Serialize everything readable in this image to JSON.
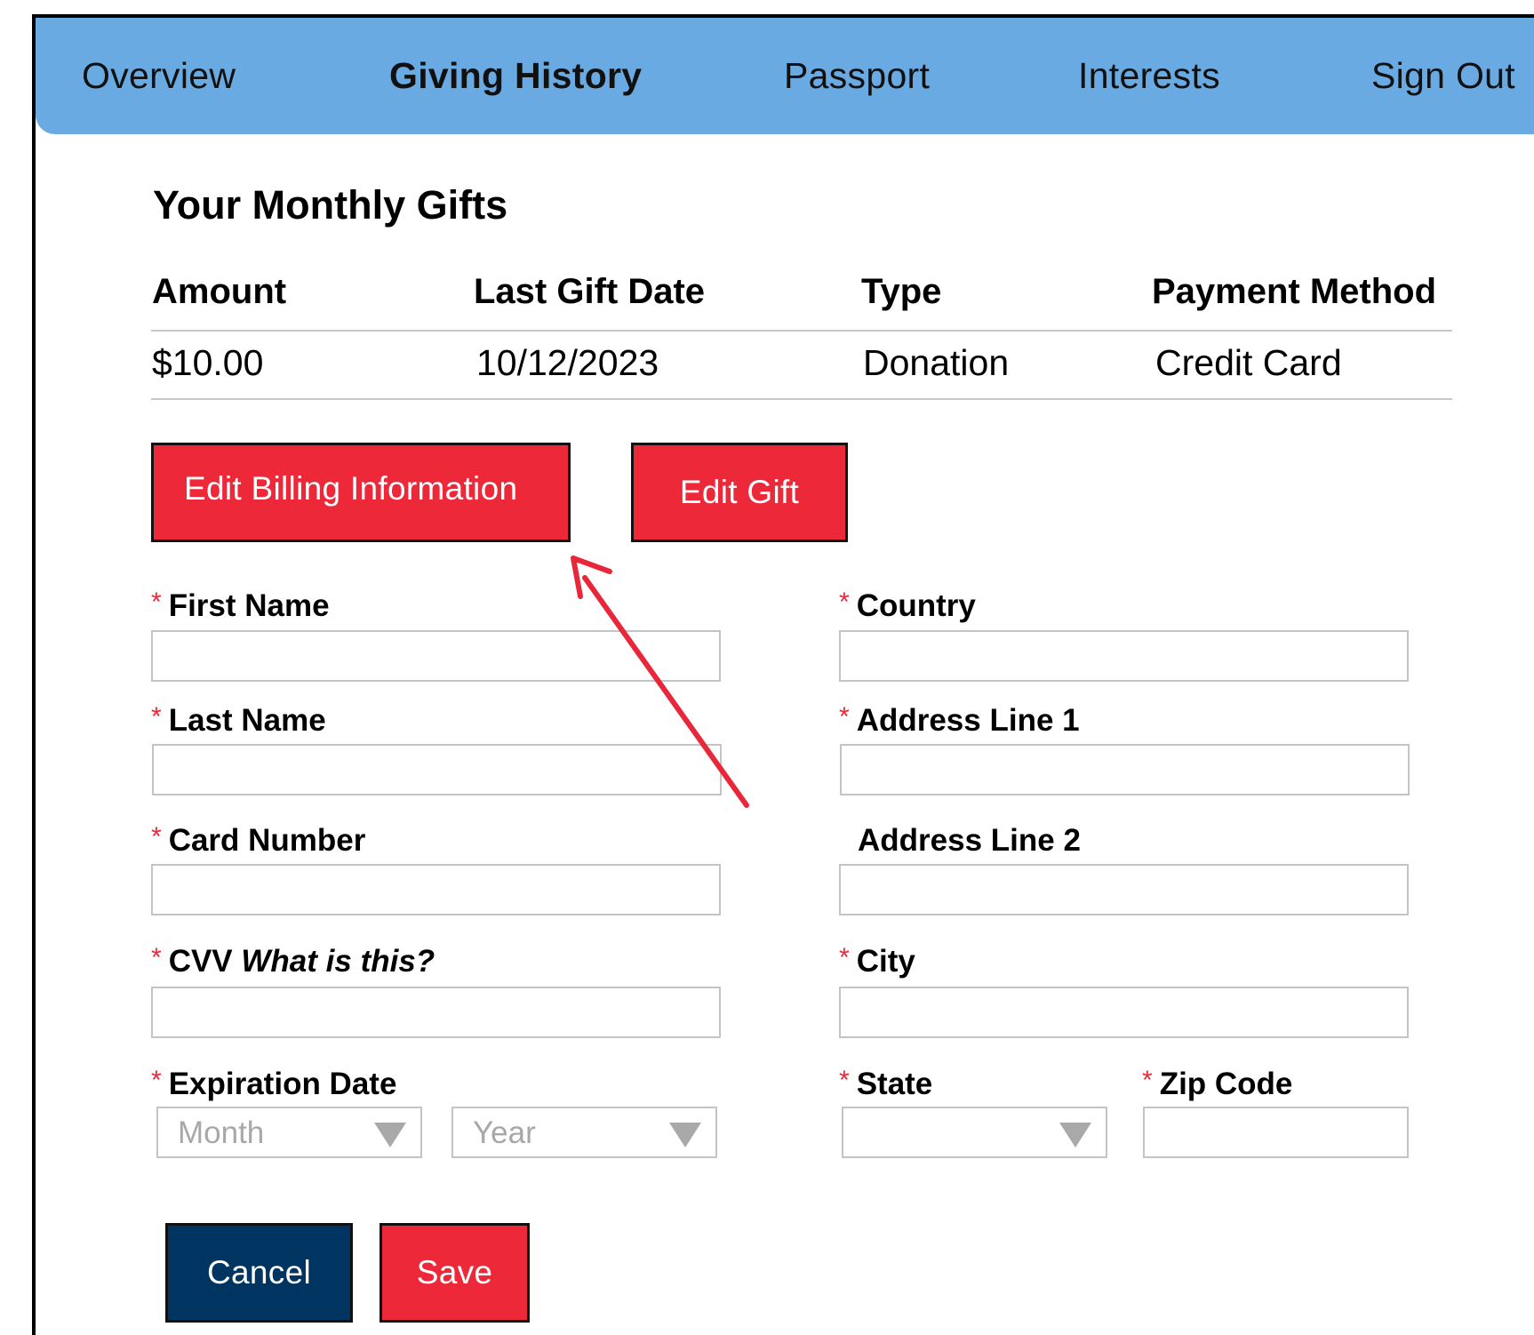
{
  "nav": {
    "items": [
      {
        "label": "Overview"
      },
      {
        "label": "Giving History",
        "active": true
      },
      {
        "label": "Passport"
      },
      {
        "label": "Interests"
      },
      {
        "label": "Sign Out"
      }
    ],
    "bg_color": "#6aaae3"
  },
  "page_title": "Your Monthly Gifts",
  "table": {
    "headers": [
      "Amount",
      "Last Gift Date",
      "Type",
      "Payment Method"
    ],
    "rows": [
      [
        "$10.00",
        "10/12/2023",
        "Donation",
        "Credit Card"
      ]
    ]
  },
  "actions": {
    "edit_billing": "Edit Billing Information",
    "edit_gift": "Edit Gift"
  },
  "form": {
    "required_marker": "*",
    "first_name": "First Name",
    "last_name": "Last Name",
    "card_number": "Card Number",
    "cvv": "CVV",
    "cvv_help": "What is this?",
    "expiration_date": "Expiration Date",
    "month_placeholder": "Month",
    "year_placeholder": "Year",
    "country": "Country",
    "address_line_1": "Address Line 1",
    "address_line_2": "Address Line 2",
    "city": "City",
    "state": "State",
    "zip_code": "Zip Code"
  },
  "buttons": {
    "cancel": "Cancel",
    "save": "Save"
  },
  "colors": {
    "accent_red": "#ec2839",
    "navy": "#003461",
    "annotation_arrow": "#e8283a"
  }
}
